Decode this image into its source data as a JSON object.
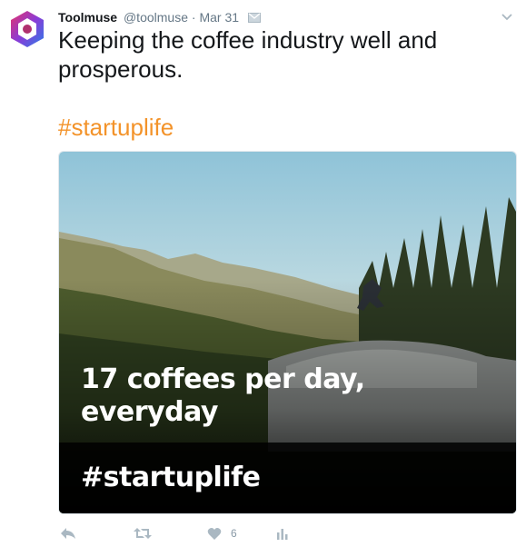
{
  "tweet": {
    "author_name": "Toolmuse",
    "author_handle": "@toolmuse",
    "separator": "·",
    "timestamp": "Mar 31",
    "text_lines": [
      "Keeping the coffee industry well and",
      "prosperous."
    ],
    "hashtag": "#startuplife"
  },
  "media": {
    "overlay_line1": "17 coffees per day,",
    "overlay_line2": "everyday",
    "overlay_hashtag": "#startuplife"
  },
  "actions": {
    "like_count": "6"
  },
  "icons": {
    "avatar": "toolmuse-hexagon-logo",
    "envelope": "envelope-icon",
    "caret": "chevron-down-icon",
    "reply": "reply-icon",
    "retweet": "retweet-icon",
    "like": "heart-icon",
    "analytics": "analytics-icon"
  },
  "colors": {
    "hashtag": "#f3932a",
    "icon_gray": "#aab8c2",
    "text": "#14171a",
    "muted": "#657786"
  }
}
